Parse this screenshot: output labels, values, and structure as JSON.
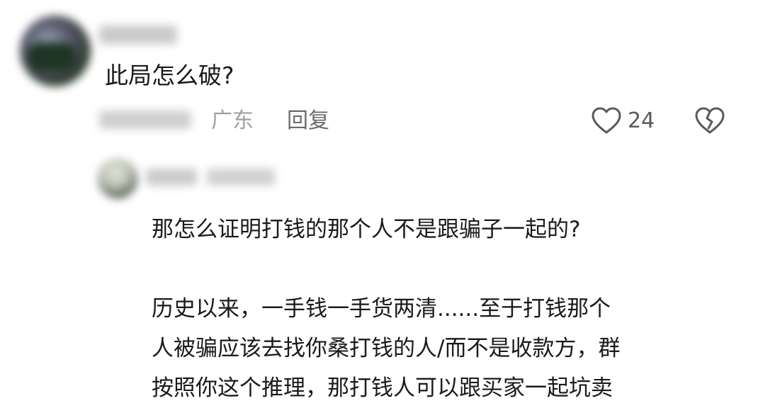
{
  "comment": {
    "text": "此局怎么破?",
    "location": "广东",
    "reply_label": "回复",
    "like_count": "24"
  },
  "reply": {
    "lines": [
      "那怎么证明打钱的那个人不是跟骗子一起的?",
      "历史以来，一手钱一手货两清......至于打钱那个",
      "人被骗应该去找你桑打钱的人/而不是收款方，群",
      "按照你这个推理，那打钱人可以跟买家一起坑卖"
    ]
  },
  "icons": {
    "like": "heart-outline-icon",
    "dislike": "broken-heart-icon"
  }
}
